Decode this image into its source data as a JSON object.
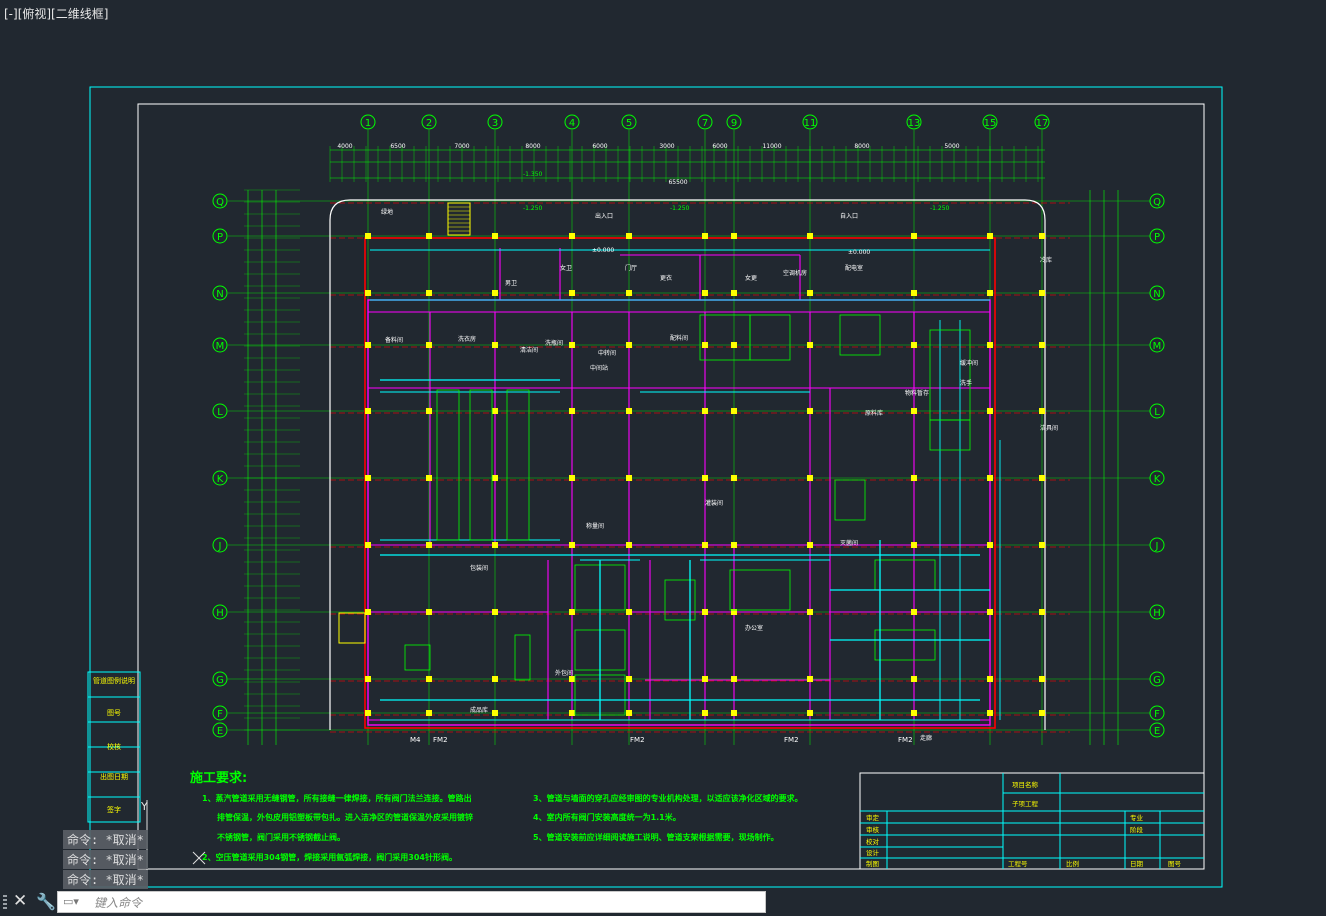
{
  "viewport": {
    "label": "[-][俯视][二维线框]"
  },
  "axes": {
    "columns": [
      "1",
      "2",
      "3",
      "4",
      "5",
      "7",
      "9",
      "11",
      "13",
      "15",
      "17"
    ],
    "rows": [
      "Q",
      "P",
      "N",
      "M",
      "L",
      "K",
      "J",
      "H",
      "G",
      "F",
      "E"
    ]
  },
  "dims": {
    "top_totals": [
      "4000",
      "6500",
      "7000",
      "8000",
      "6000",
      "3000",
      "6000",
      "11000",
      "8000",
      "5000"
    ],
    "overall": "65500",
    "elev_minus_1350": "-1.350",
    "elev_minus_1250": "-1.250",
    "elev_zero": "±0.000"
  },
  "rooms": [
    "绿地",
    "出入口",
    "自入口",
    "门厅",
    "更衣",
    "女更",
    "男卫",
    "女卫",
    "空调机房",
    "配电室",
    "冷库",
    "备料间",
    "洗衣房",
    "清洁间",
    "洗瓶间",
    "中转间",
    "中间站",
    "配料间",
    "称量间",
    "灌装间",
    "包装间",
    "外包间",
    "成品库",
    "原料库",
    "物料暂存",
    "洁具间",
    "走廊",
    "缓冲间",
    "洗手",
    "灭菌间",
    "办公室"
  ],
  "doors": [
    "M4",
    "FM2",
    "FM2",
    "FM2",
    "FM2"
  ],
  "left_table": {
    "rows": [
      "管道图例说明",
      "图号",
      "校核",
      "出图日期",
      "签字"
    ]
  },
  "notes": {
    "title": "施工要求:",
    "items": [
      "1、蒸汽管道采用无缝钢管，所有接缝一律焊接，所有阀门法兰连接。管路出",
      "排管保温，外包皮用铝塑板带包扎。进入洁净区的管道保温外皮采用镀锌",
      "不锈钢管，阀门采用不锈钢截止阀。",
      "2、空压管道采用304钢管，焊接采用氩弧焊接，阀门采用304针形阀。",
      "3、管道与墙面的穿孔应经审图的专业机构处理，以适应该净化区域的要求。",
      "4、室内所有阀门安装高度统一为1.1米。",
      "5、管道安装前应详细阅读施工说明、管道支架根据需要，现场制作。"
    ]
  },
  "title_block": {
    "project_name_label": "项目名称",
    "sub_project_label": "子项工程",
    "left_labels": [
      "审定",
      "审核",
      "校对",
      "设计",
      "制图"
    ],
    "right_labels": [
      "专业",
      "阶段"
    ],
    "bottom_labels": [
      "工程号",
      "比例",
      "日期",
      "图号"
    ]
  },
  "command_history": [
    "命令: *取消*",
    "命令: *取消*",
    "命令: *取消*"
  ],
  "command_input": {
    "placeholder": "键入命令"
  },
  "colors": {
    "background": "#212830",
    "frame_cyan": "#00ffff",
    "axis_green": "#00ff00",
    "wall_magenta": "#ff00ff",
    "column_yellow": "#ffff00",
    "red_line": "#ff0000",
    "dim_white": "#ffffff"
  }
}
